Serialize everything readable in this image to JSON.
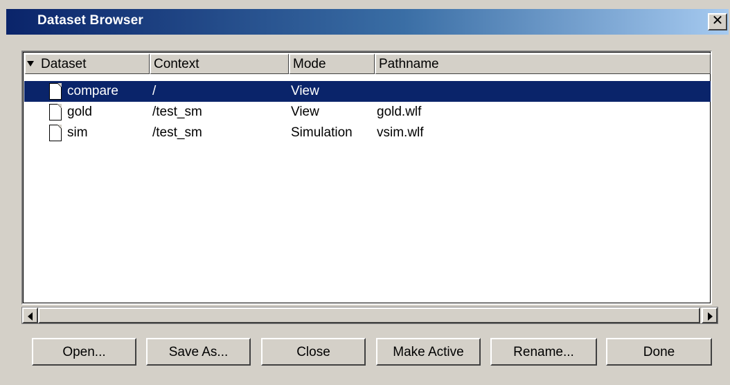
{
  "window": {
    "title": "Dataset Browser",
    "close_glyph": "✕"
  },
  "table": {
    "columns": [
      {
        "label": "Dataset",
        "sorted": "descending"
      },
      {
        "label": "Context"
      },
      {
        "label": "Mode"
      },
      {
        "label": "Pathname"
      }
    ],
    "rows": [
      {
        "dataset": "compare",
        "context": "/",
        "mode": "View",
        "pathname": "",
        "selected": true,
        "icon": "file-icon"
      },
      {
        "dataset": "gold",
        "context": "/test_sm",
        "mode": "View",
        "pathname": "gold.wlf",
        "selected": false,
        "icon": "file-icon"
      },
      {
        "dataset": "sim",
        "context": "/test_sm",
        "mode": "Simulation",
        "pathname": "vsim.wlf",
        "selected": false,
        "icon": "file-icon"
      }
    ]
  },
  "buttons": {
    "open": "Open...",
    "save_as": "Save As...",
    "close": "Close",
    "make_active": "Make Active",
    "rename": "Rename...",
    "done": "Done"
  },
  "colors": {
    "selection": "#0a246a",
    "face": "#d4d0c8"
  }
}
